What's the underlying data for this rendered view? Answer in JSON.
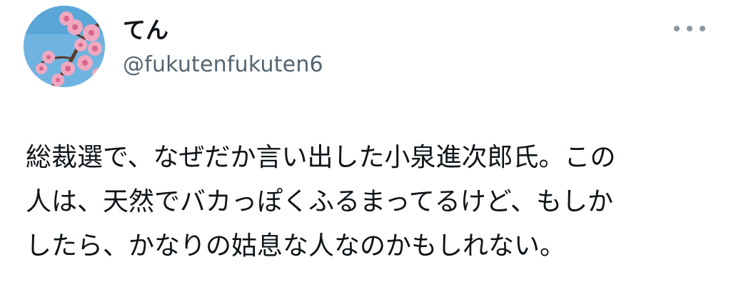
{
  "user": {
    "display_name": "てん",
    "handle": "@fukutenfukuten6",
    "avatar_icon": "cherry-blossom-avatar"
  },
  "menu": {
    "icon": "more-options-icon"
  },
  "tweet": {
    "lines": [
      "総裁選で、なぜだか言い出した小泉進次郎氏。この",
      "人は、天然でバカっぽくふるまってるけど、もしか",
      "したら、かなりの姑息な人なのかもしれない。"
    ]
  },
  "colors": {
    "text_primary": "#0f1419",
    "text_secondary": "#536471",
    "avatar_sky": "#6fb4e0",
    "blossom_pink": "#e88aa8"
  }
}
